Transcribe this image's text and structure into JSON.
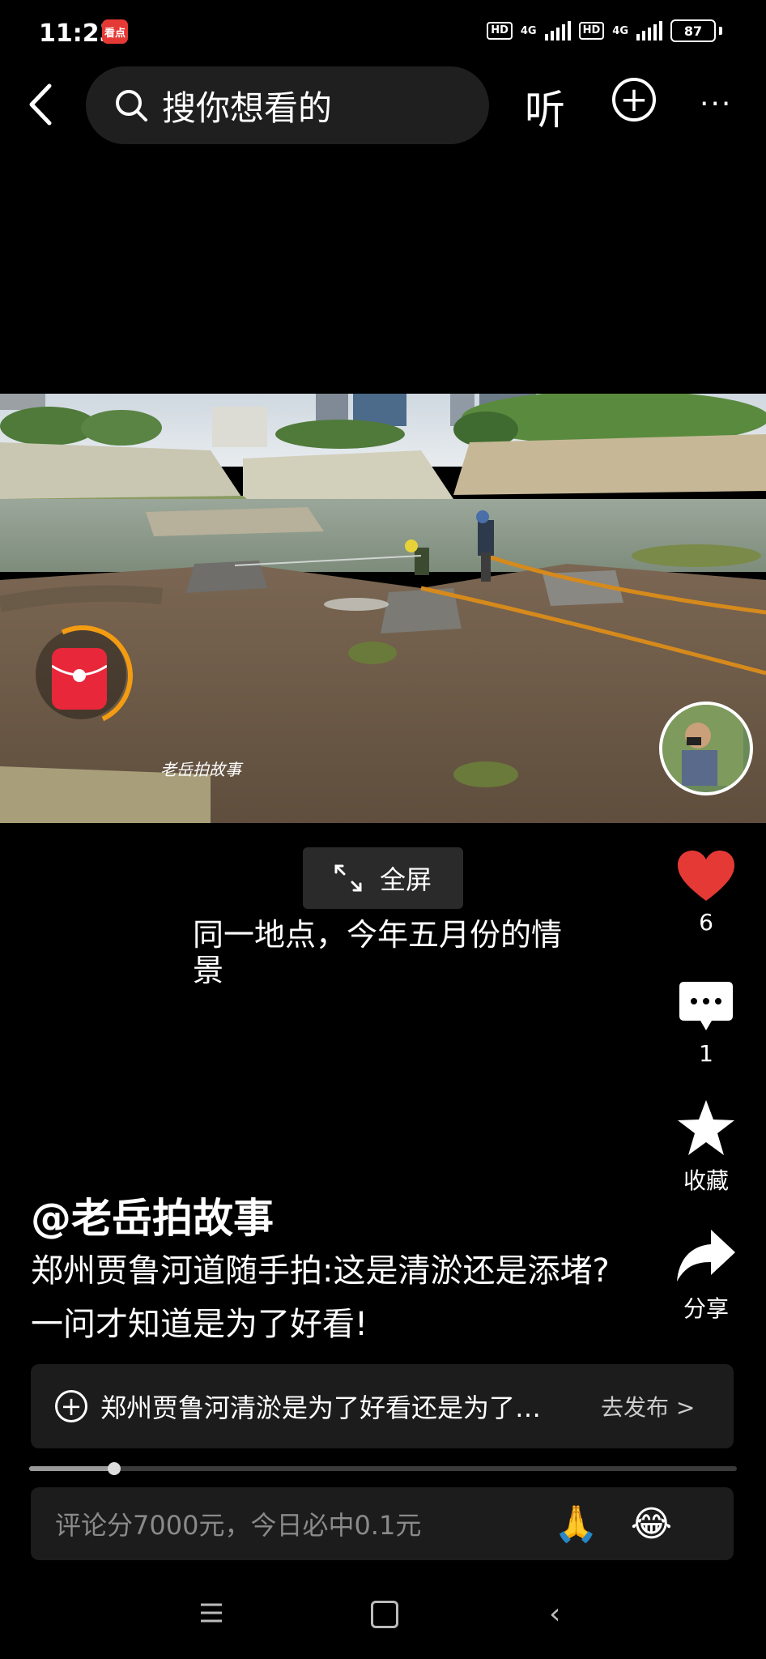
{
  "status_bar": {
    "time": "11:23",
    "app_badge": "看点",
    "network1": "4G",
    "network2": "4G",
    "hd1": "HD",
    "hd2": "HD",
    "battery": "87"
  },
  "top_nav": {
    "search_placeholder": "搜你想看的",
    "listen_label": "听"
  },
  "video": {
    "watermark": "老岳拍故事",
    "fullscreen_label": "全屏",
    "caption": "同一地点，今年五月份的情景",
    "progress_fraction": 0.12
  },
  "actions": {
    "like_count": "6",
    "comment_count": "1",
    "favorite_label": "收藏",
    "share_label": "分享"
  },
  "post": {
    "author": "@老岳拍故事",
    "title": "郑州贾鲁河道随手拍:这是清淤还是添堵? 一问才知道是为了好看!"
  },
  "topic": {
    "text": "郑州贾鲁河清淤是为了好看还是为了…",
    "action_label": "去发布 >"
  },
  "comment_bar": {
    "placeholder": "评论分7000元，今日必中0.1元",
    "emoji1": "🙏",
    "emoji2": "😂"
  },
  "colors": {
    "like_red": "#e53935",
    "background": "#000000"
  }
}
